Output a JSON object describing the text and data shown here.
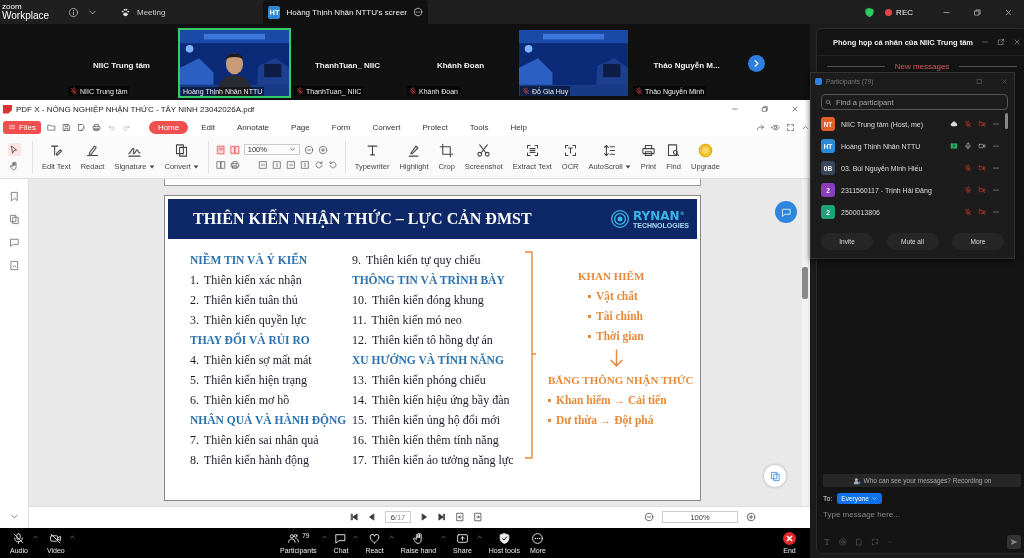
{
  "top_bar": {
    "logo": {
      "brand": "zoom",
      "product": "Workplace"
    },
    "tabs": [
      {
        "label": "Meeting",
        "selected": false
      },
      {
        "label": "Hoàng Thịnh Nhân NTTU's screer",
        "selected": true,
        "badge": "HT"
      }
    ],
    "recording_label": "REC"
  },
  "video_strip": {
    "tiles": [
      {
        "kind": "name",
        "name": "NIIC Trung tâm",
        "label": "NIIC Trung tâm",
        "muted": true
      },
      {
        "kind": "video",
        "label": "Hoàng Thịnh Nhân NTTU",
        "muted": false,
        "speaking": true
      },
      {
        "kind": "name",
        "name": "ThanhTuan_ NIIC",
        "label": "ThanhTuan_ NIIC",
        "muted": true
      },
      {
        "kind": "name",
        "name": "Khánh Đoan",
        "label": "Khánh Đoan",
        "muted": true
      },
      {
        "kind": "video",
        "label": "Đỗ Gia Huy",
        "muted": true,
        "speaking": false
      },
      {
        "kind": "name",
        "name": "Thảo  Nguyễn M...",
        "label": "Thảo Nguyễn Minh",
        "muted": true
      }
    ]
  },
  "pdf": {
    "title": "PDF X - NÔNG NGHIỆP NHẬN THỨC - TÂY NINH 23042026A.pdf",
    "files": "Files",
    "menu": [
      {
        "label": "Home",
        "selected": true
      },
      {
        "label": "Edit",
        "selected": false
      },
      {
        "label": "Annotate",
        "selected": false
      },
      {
        "label": "Page",
        "selected": false
      },
      {
        "label": "Form",
        "selected": false
      },
      {
        "label": "Convert",
        "selected": false
      },
      {
        "label": "Protect",
        "selected": false
      },
      {
        "label": "Tools",
        "selected": false
      },
      {
        "label": "Help",
        "selected": false
      }
    ],
    "tools_left": [
      {
        "label": "Edit Text",
        "dropdown": false
      },
      {
        "label": "Redact",
        "dropdown": false
      },
      {
        "label": "Signature",
        "dropdown": true
      },
      {
        "label": "Convert",
        "dropdown": true
      }
    ],
    "zoom": "100%",
    "tools_right": [
      {
        "label": "Typewriter",
        "dropdown": false
      },
      {
        "label": "Highlight",
        "dropdown": false
      },
      {
        "label": "Crop",
        "dropdown": false
      },
      {
        "label": "Screenshot",
        "dropdown": false
      },
      {
        "label": "Extract Text",
        "dropdown": false
      },
      {
        "label": "OCR",
        "dropdown": false
      },
      {
        "label": "AutoScroll",
        "dropdown": true
      },
      {
        "label": "Print",
        "dropdown": false
      },
      {
        "label": "Find",
        "dropdown": false
      },
      {
        "label": "Upgrade",
        "dropdown": false
      }
    ],
    "slide": {
      "title": "THIÊN KIẾN NHẬN THỨC – LỰC CẢN ĐMST",
      "logo": {
        "name": "RYNAN",
        "sub": "TECHNOLOGIES",
        "mark": "®"
      },
      "columns": [
        [
          {
            "kind": "heading",
            "text": "NIỀM TIN VÀ Ý KIẾN"
          },
          {
            "kind": "item",
            "num": "1.",
            "text": "Thiên kiến xác nhận"
          },
          {
            "kind": "item",
            "num": "2.",
            "text": "Thiên kiến tuân thủ"
          },
          {
            "kind": "item",
            "num": "3.",
            "text": "Thiên kiến quyền lực"
          },
          {
            "kind": "heading",
            "text": "THAY ĐỔI VÀ RỦI RO"
          },
          {
            "kind": "item",
            "num": "4.",
            "text": "Thiên kiến sợ mất mát"
          },
          {
            "kind": "item",
            "num": "5.",
            "text": "Thiên kiến hiện trạng"
          },
          {
            "kind": "item",
            "num": "6.",
            "text": "Thiên kiến mơ hồ"
          },
          {
            "kind": "heading",
            "text": "NHÂN QUẢ VÀ HÀNH ĐỘNG"
          },
          {
            "kind": "item",
            "num": "7.",
            "text": "Thiên kiến sai nhân quả"
          },
          {
            "kind": "item",
            "num": "8.",
            "text": "Thiên kiến hành động"
          }
        ],
        [
          {
            "kind": "item",
            "num": "9.",
            "text": "Thiên kiến tự quy chiếu"
          },
          {
            "kind": "heading",
            "text": "THÔNG TIN VÀ TRÌNH BÀY"
          },
          {
            "kind": "item",
            "num": "10.",
            "text": "Thiên kiến đóng khung"
          },
          {
            "kind": "item",
            "num": "11.",
            "text": "Thiên kiến mỏ neo"
          },
          {
            "kind": "item",
            "num": "12.",
            "text": "Thiên kiến tô hồng dự án"
          },
          {
            "kind": "heading",
            "text": "XU HƯỚNG VÀ TÍNH NĂNG"
          },
          {
            "kind": "item",
            "num": "13.",
            "text": "Thiên kiến phóng chiếu"
          },
          {
            "kind": "item",
            "num": "14.",
            "text": "Thiên kiến hiệu ứng bầy đàn"
          },
          {
            "kind": "item",
            "num": "15.",
            "text": "Thiên kiến ủng hộ đổi mới"
          },
          {
            "kind": "item",
            "num": "16.",
            "text": "Thiên kiến thêm tính năng"
          },
          {
            "kind": "item",
            "num": "17.",
            "text": "Thiên kiến ảo tưởng năng lực"
          }
        ]
      ],
      "summary": [
        {
          "kind": "heading",
          "text": "KHAN HIẾM"
        },
        {
          "kind": "bullet",
          "text": "Vật chất"
        },
        {
          "kind": "bullet",
          "text": "Tài chính"
        },
        {
          "kind": "bullet",
          "text": "Thời gian"
        },
        {
          "kind": "arrow"
        },
        {
          "kind": "heading",
          "text": "BĂNG THÔNG NHẬN THỨC"
        },
        {
          "kind": "bullet",
          "text": "Khan hiếm → Cải tiến"
        },
        {
          "kind": "bullet",
          "text": "Dư thừa → Đột phá"
        }
      ]
    },
    "page_nav": {
      "current": "6",
      "total": "/17",
      "zoom": "100%"
    }
  },
  "controls": [
    {
      "kind": "audio",
      "label": "Audio",
      "off": true,
      "menu": true
    },
    {
      "kind": "video",
      "label": "Video",
      "off": true,
      "menu": true
    },
    {
      "kind": "participants",
      "label": "Participants",
      "count": "79",
      "menu": true
    },
    {
      "kind": "chat",
      "label": "Chat",
      "menu": true
    },
    {
      "kind": "react",
      "label": "React",
      "menu": true
    },
    {
      "kind": "hand",
      "label": "Raise hand",
      "menu": true
    },
    {
      "kind": "share",
      "label": "Share",
      "menu": true
    },
    {
      "kind": "host",
      "label": "Host tools",
      "menu": false
    },
    {
      "kind": "more",
      "label": "More",
      "menu": false
    },
    {
      "kind": "end",
      "label": "End",
      "menu": false
    }
  ],
  "chat": {
    "title": "Phòng họp cá nhân của NIIC Trung tâm",
    "divider": "New messages",
    "notice": "Who can see your messages? Recording on",
    "to_label": "To:",
    "recipient": "Everyone",
    "placeholder": "Type message here..."
  },
  "participants": {
    "title": "Participants (79)",
    "search_placeholder": "Find a participant",
    "people": [
      {
        "initials": "NT",
        "color": "#e2612a",
        "name": "NIIC Trung tâm (Host, me)",
        "recording": true,
        "sharing": false,
        "muted": true,
        "video_off": true
      },
      {
        "initials": "HT",
        "color": "#2d8ad6",
        "name": "Hoàng Thịnh Nhân NTTU",
        "recording": false,
        "sharing": true,
        "muted": false,
        "video_off": false
      },
      {
        "initials": "0B",
        "color": "#38475a",
        "name": "03. Bùi Nguyễn Minh Hiếu",
        "recording": false,
        "sharing": false,
        "muted": true,
        "video_off": true
      },
      {
        "initials": "2",
        "color": "#8a3dbd",
        "name": "2311560117 - Trịnh Hải Đăng",
        "recording": false,
        "sharing": false,
        "muted": true,
        "video_off": true
      },
      {
        "initials": "2",
        "color": "#1ca37a",
        "name": "2500013806",
        "recording": false,
        "sharing": false,
        "muted": true,
        "video_off": true
      }
    ],
    "buttons": [
      "Invite",
      "Mute all",
      "More"
    ]
  }
}
